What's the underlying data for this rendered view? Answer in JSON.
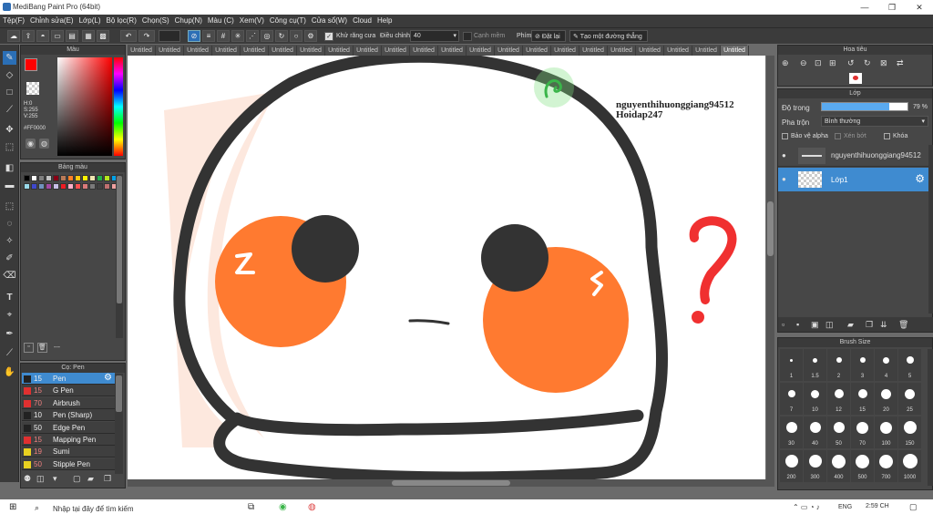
{
  "window": {
    "title": "MediBang Paint Pro (64bit)",
    "minimize": "—",
    "maximize": "❐",
    "close": "✕"
  },
  "menu": [
    "Tệp(F)",
    "Chỉnh sửa(E)",
    "Lớp(L)",
    "Bộ lọc(R)",
    "Chọn(S)",
    "Chụp(N)",
    "Màu (C)",
    "Xem(V)",
    "Công cụ(T)",
    "Cửa sổ(W)",
    "Cloud",
    "Help"
  ],
  "toolbar": {
    "antialias_label": "Khử răng cưa",
    "correction_label": "Điều chỉnh",
    "correction_value": "40",
    "soft_edge_label": "Cạnh mềm",
    "key_label": "Phím",
    "reset_label": "Đặt lại",
    "straight_line_label": "Tạo một đường thẳng"
  },
  "document_tabs": [
    "Untitled",
    "Untitled",
    "Untitled",
    "Untitled",
    "Untitled",
    "Untitled",
    "Untitled",
    "Untitled",
    "Untitled",
    "Untitled",
    "Untitled",
    "Untitled",
    "Untitled",
    "Untitled",
    "Untitled",
    "Untitled",
    "Untitled",
    "Untitled",
    "Untitled",
    "Untitled",
    "Untitled",
    "Untitled"
  ],
  "color_panel": {
    "title": "Màu",
    "h_label": "H:0",
    "s_label": "S:255",
    "v_label": "V:255",
    "hex": "#FF0000",
    "primary": "#ff0000",
    "secondary": "#000000"
  },
  "palette_panel": {
    "title": "Bảng màu",
    "counter": "---",
    "swatches": [
      "#000000",
      "#ffffff",
      "#7f7f7f",
      "#c3c3c3",
      "#880015",
      "#b97a57",
      "#ff7f27",
      "#ffc90e",
      "#fff200",
      "#efe4b0",
      "#22b14c",
      "#b5e61d",
      "#00a2e8",
      "#99d9ea",
      "#3f48cc",
      "#7092be",
      "#a349a4",
      "#c8bfe7",
      "#ed1c24",
      "#ffaec9",
      "#ff5050",
      "#d97a7a",
      "#7a7a7a",
      "#404040",
      "#c07070",
      "#f0a0a0"
    ]
  },
  "brush_panel": {
    "title": "Cọ: Pen",
    "items": [
      {
        "size": "15",
        "name": "Pen",
        "color": "#222222",
        "selected": true
      },
      {
        "size": "15",
        "name": "G Pen",
        "color": "#e03030"
      },
      {
        "size": "70",
        "name": "Airbrush",
        "color": "#e03030"
      },
      {
        "size": "10",
        "name": "Pen (Sharp)",
        "color": "#222222"
      },
      {
        "size": "50",
        "name": "Edge Pen",
        "color": "#222222"
      },
      {
        "size": "15",
        "name": "Mapping Pen",
        "color": "#e03030"
      },
      {
        "size": "19",
        "name": "Sumi",
        "color": "#e8d020"
      },
      {
        "size": "50",
        "name": "Stipple Pen",
        "color": "#e8d020"
      }
    ]
  },
  "navigator_panel": {
    "title": "Hoa tiêu"
  },
  "layer_panel": {
    "title": "Lớp",
    "opacity_label": "Độ trong",
    "opacity_value": "79 %",
    "opacity_fraction": 0.79,
    "blend_label": "Pha trộn",
    "blend_value": "Bình thường",
    "protect_alpha_label": "Bảo vệ alpha",
    "clipping_label": "Xén bớt",
    "lock_label": "Khóa",
    "layers": [
      {
        "name": "nguyenthihuonggiang94512",
        "selected": false
      },
      {
        "name": "Lớp1",
        "selected": true
      }
    ]
  },
  "brush_size_panel": {
    "title": "Brush Size",
    "sizes": [
      "1",
      "1.5",
      "2",
      "3",
      "4",
      "5",
      "7",
      "10",
      "12",
      "15",
      "20",
      "25",
      "30",
      "40",
      "50",
      "70",
      "100",
      "150",
      "200",
      "300",
      "400",
      "500",
      "700",
      "1000"
    ]
  },
  "artwork": {
    "text_line1": "nguyenthihuonggiang94512",
    "text_line2": "Hoidap247",
    "question_mark": "?",
    "outline_color": "#333333",
    "cheek_color": "#ff7a30",
    "shade_color": "#fde8de"
  },
  "taskbar": {
    "search_placeholder": "Nhập tại đây để tìm kiếm",
    "time": "2:59 CH",
    "lang": "ENG"
  }
}
